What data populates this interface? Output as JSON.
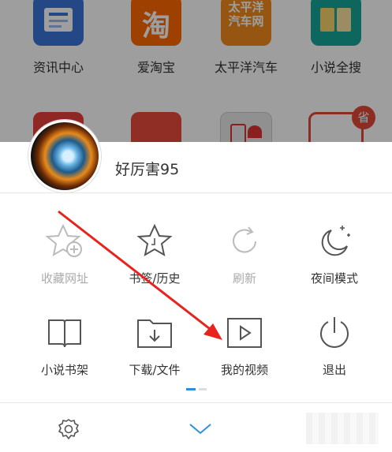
{
  "background_apps": [
    {
      "label": "资讯中心",
      "icon": "news-icon",
      "color": "#3b73d9",
      "glyph": ""
    },
    {
      "label": "爱淘宝",
      "icon": "taobao-icon",
      "color": "#ff6a00",
      "glyph": "淘"
    },
    {
      "label": "太平洋汽车",
      "icon": "pcauto-icon",
      "color": "#f28c1e",
      "glyph": "太平洋\n汽车网"
    },
    {
      "label": "小说全搜",
      "icon": "novel-search-icon",
      "color": "#17a69a",
      "glyph": ""
    }
  ],
  "background_apps_row2_colors": [
    "#e7413a",
    "#e84a3a",
    "#6a6a6a",
    "#e24a3a"
  ],
  "badge_text": "省",
  "profile": {
    "username": "好厉害95"
  },
  "menu": [
    {
      "label": "收藏网址",
      "icon": "add-bookmark-icon",
      "disabled": true
    },
    {
      "label": "书签/历史",
      "icon": "star-icon",
      "disabled": false
    },
    {
      "label": "刷新",
      "icon": "refresh-icon",
      "disabled": true
    },
    {
      "label": "夜间模式",
      "icon": "moon-icon",
      "disabled": false
    },
    {
      "label": "小说书架",
      "icon": "book-icon",
      "disabled": false
    },
    {
      "label": "下载/文件",
      "icon": "download-folder-icon",
      "disabled": false
    },
    {
      "label": "我的视频",
      "icon": "video-icon",
      "disabled": false
    },
    {
      "label": "退出",
      "icon": "power-icon",
      "disabled": false
    }
  ],
  "colors": {
    "accent": "#2b8fe0",
    "arrow": "#e8231d",
    "text": "#333333",
    "muted": "#aaaaaa"
  }
}
